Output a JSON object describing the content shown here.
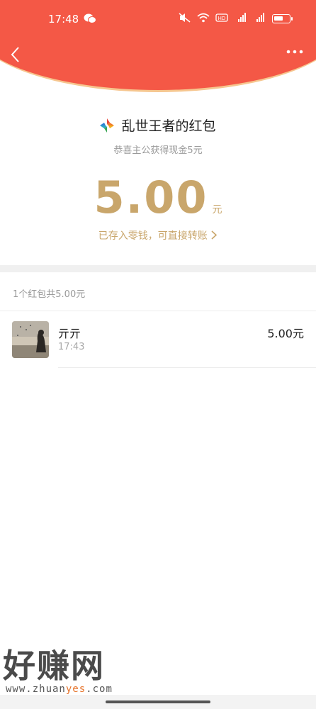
{
  "status_bar": {
    "time": "17:48"
  },
  "header": {
    "back_icon": "chevron-left-icon",
    "more_icon": "more-dots-icon",
    "accent_color": "#f45846"
  },
  "hongbao": {
    "sender_title": "乱世王者的红包",
    "subtitle": "恭喜主公获得现金5元",
    "amount": "5.00",
    "unit": "元",
    "saved_link": "已存入零钱，可直接转账",
    "amount_color": "#c9a66b"
  },
  "summary": "1个红包共5.00元",
  "records": [
    {
      "name": "亓亓",
      "time": "17:43",
      "amount": "5.00元"
    }
  ],
  "watermark": {
    "cn": "好赚网",
    "url_prefix": "www.zhuan",
    "url_highlight": "yes",
    "url_suffix": ".com"
  }
}
